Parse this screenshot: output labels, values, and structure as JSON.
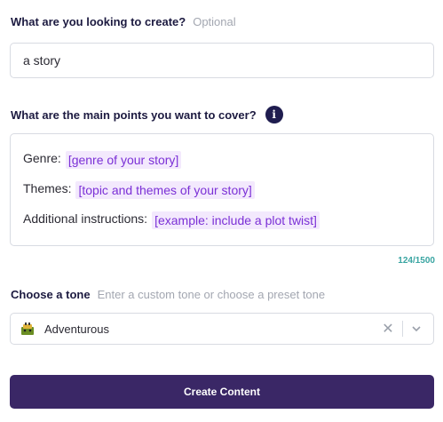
{
  "create": {
    "label": "What are you looking to create?",
    "optional": "Optional",
    "value": "a story"
  },
  "points": {
    "label": "What are the main points you want to cover?",
    "info_icon": "info-icon",
    "lines": [
      {
        "key": "Genre:",
        "placeholder": "[genre of your story]"
      },
      {
        "key": "Themes:",
        "placeholder": "[topic and themes of your story]"
      },
      {
        "key": "Additional instructions:",
        "placeholder": "[example: include a plot twist]"
      }
    ],
    "counter": "124/1500"
  },
  "tone": {
    "label": "Choose a tone",
    "hint": "Enter a custom tone or choose a preset tone",
    "selected": "Adventurous",
    "icon": "adventure-icon",
    "clear_icon": "close-icon",
    "chevron_icon": "chevron-down-icon"
  },
  "button": {
    "label": "Create Content",
    "color": "#3a2766"
  },
  "colors": {
    "chip_bg": "#f3e9fd",
    "chip_text": "#7b30d6",
    "counter": "#3aa5a2"
  }
}
